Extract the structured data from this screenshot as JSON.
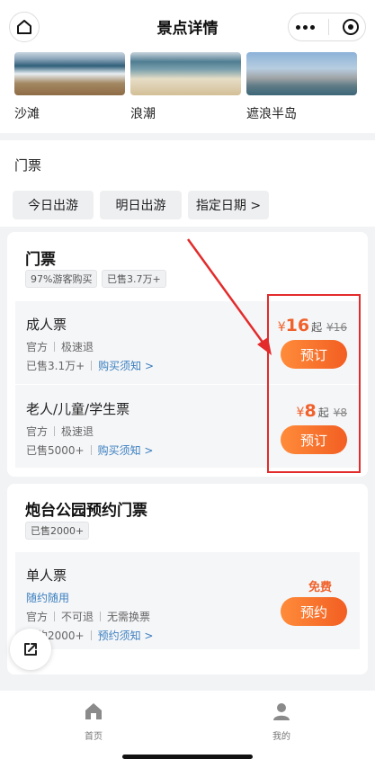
{
  "header": {
    "title": "景点详情"
  },
  "spots": [
    {
      "name": "沙滩"
    },
    {
      "name": "浪潮"
    },
    {
      "name": "遮浪半岛"
    }
  ],
  "ticket_section": {
    "title": "门票",
    "date_options": [
      "今日出游",
      "明日出游",
      "指定日期 >"
    ]
  },
  "card1": {
    "title": "门票",
    "tags": [
      "97%游客购买",
      "已售3.7万+"
    ],
    "tickets": [
      {
        "name": "成人票",
        "meta": [
          "官方",
          "极速退"
        ],
        "sold": "已售3.1万+",
        "notice": "购买须知 >",
        "currency": "¥",
        "price": "16",
        "price_suffix": "起",
        "original_price": "¥16",
        "button": "预订"
      },
      {
        "name": "老人/儿童/学生票",
        "meta": [
          "官方",
          "极速退"
        ],
        "sold": "已售5000+",
        "notice": "购买须知 >",
        "currency": "¥",
        "price": "8",
        "price_suffix": "起",
        "original_price": "¥8",
        "button": "预订"
      }
    ]
  },
  "card2": {
    "title": "炮台公园预约门票",
    "tags": [
      "已售2000+"
    ],
    "ticket": {
      "name": "单人票",
      "highlight": "随约随用",
      "meta": [
        "官方",
        "不可退",
        "无需换票"
      ],
      "sold": "已约2000+",
      "notice": "预约须知 >",
      "price_label": "免费",
      "button": "预约"
    }
  },
  "tabbar": {
    "items": [
      {
        "label": "首页",
        "icon": "home-icon"
      },
      {
        "label": "我的",
        "icon": "user-icon"
      }
    ]
  },
  "colors": {
    "accent": "#f0612b",
    "link": "#3b7fbf",
    "annotation": "#e32b2b"
  }
}
